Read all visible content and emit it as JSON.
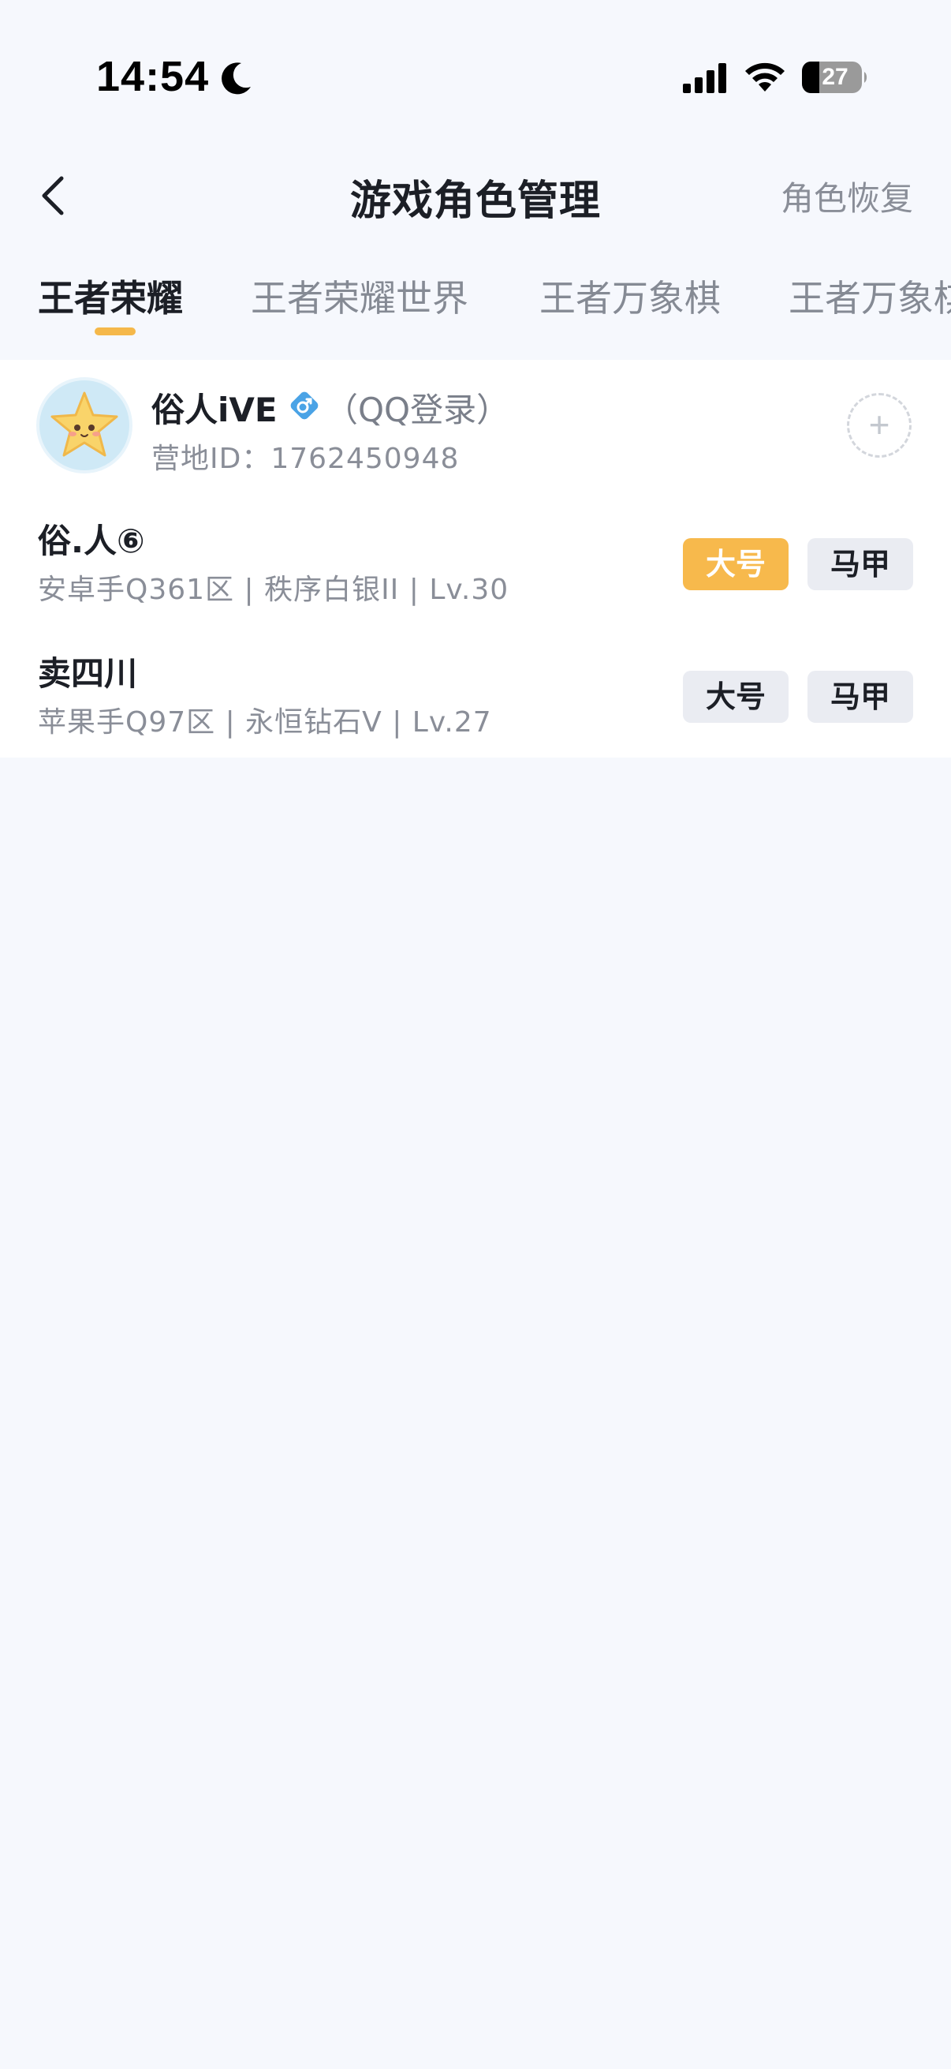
{
  "status_bar": {
    "time": "14:54",
    "battery": "27",
    "icons": [
      "moon-icon",
      "signal-icon",
      "wifi-icon",
      "battery-icon"
    ]
  },
  "nav": {
    "title": "游戏角色管理",
    "restore_label": "角色恢复",
    "back_icon": "chevron-left-icon"
  },
  "tabs": [
    {
      "label": "王者荣耀",
      "active": true
    },
    {
      "label": "王者荣耀世界",
      "active": false
    },
    {
      "label": "王者万象棋",
      "active": false
    },
    {
      "label": "王者万象棋",
      "active": false
    }
  ],
  "account": {
    "name": "俗人iVE",
    "gender_icon": "male-icon",
    "login_type": "（QQ登录）",
    "camp_id": "营地ID：1762450948",
    "add_icon": "plus-icon"
  },
  "roles": [
    {
      "name": "俗.人⑥",
      "detail": "安卓手Q361区 | 秩序白银II | Lv.30",
      "main_label": "大号",
      "alt_label": "马甲",
      "main_selected": true
    },
    {
      "name": "卖四川",
      "detail": "苹果手Q97区 | 永恒钻石V | Lv.27",
      "main_label": "大号",
      "alt_label": "马甲",
      "main_selected": false
    }
  ],
  "colors": {
    "accent": "#f7b94c",
    "background": "#f6f8fd",
    "card": "#ffffff",
    "tag_bg": "#eaecf2",
    "male_icon": "#4aa3e6"
  }
}
